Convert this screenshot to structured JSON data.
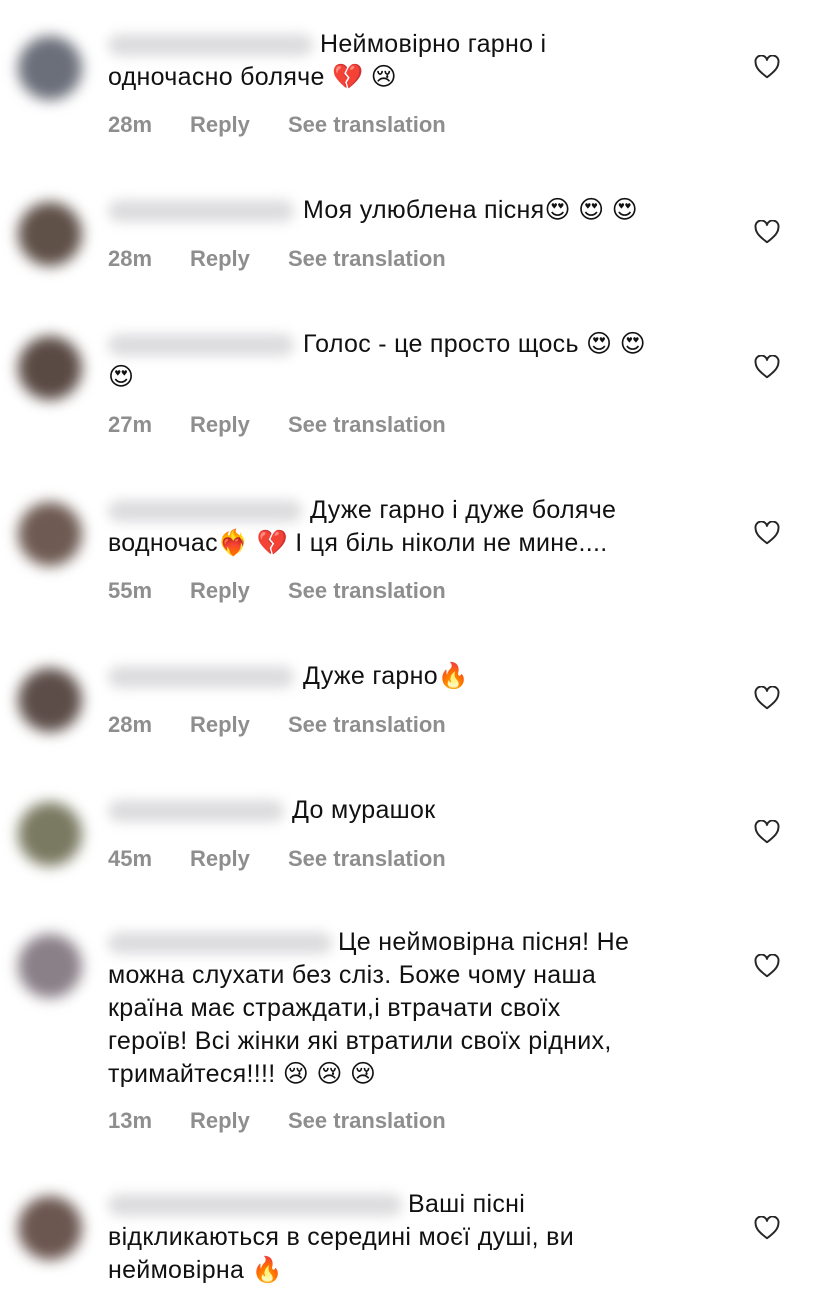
{
  "comments": [
    {
      "text": "Неймовірно гарно і\nодночасно боляче 💔 😢",
      "time": "28m"
    },
    {
      "text": "Моя улюблена пісня😍 😍 😍",
      "time": "28m"
    },
    {
      "text": "Голос - це просто щось 😍 😍\n😍",
      "time": "27m"
    },
    {
      "text": "Дуже гарно і дуже боляче\nводночас❤️‍🔥 💔 І ця біль ніколи не мине....",
      "time": "55m"
    },
    {
      "text": "Дуже гарно🔥",
      "time": "28m"
    },
    {
      "text": "До мурашок",
      "time": "45m"
    },
    {
      "text": "Це неймовірна пісня! Не\nможна слухати без сліз. Боже чому наша\nкраїна має страждати,і втрачати своїх\nгероїв! Всі жінки які втратили своїх рідних,\nтримайтеся!!!! 😢 😢 😢",
      "time": "13m"
    },
    {
      "text": "Ваші пісні\nвідкликаються в середині моєї душі, ви\nнеймовірна 🔥",
      "time": ""
    }
  ],
  "labels": {
    "reply": "Reply",
    "see_translation": "See translation"
  },
  "icons": {
    "like": "heart-outline-icon"
  },
  "colors": {
    "meta": "#8e8e8e",
    "text": "#111111"
  }
}
